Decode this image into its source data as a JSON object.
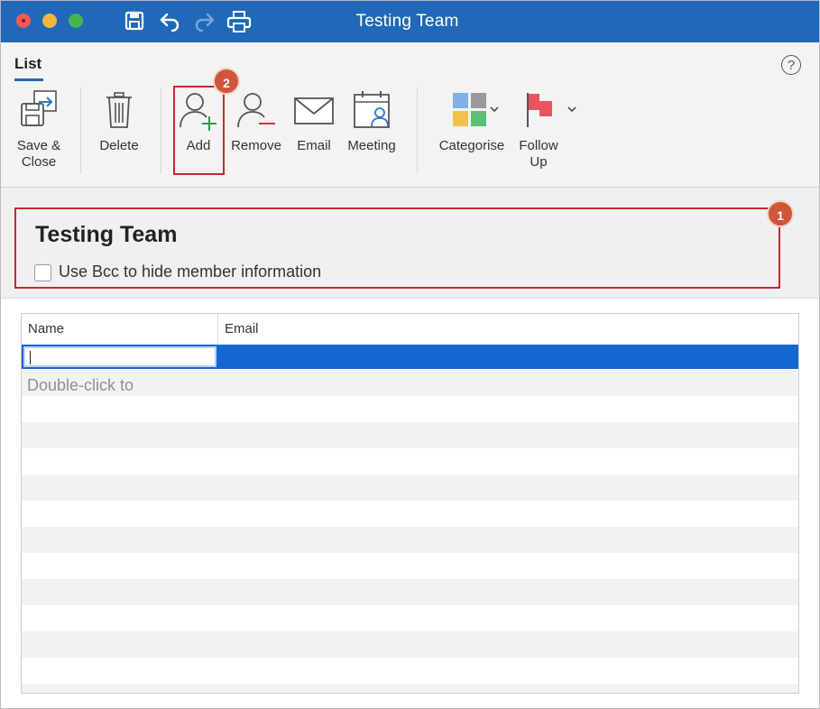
{
  "window": {
    "title": "Testing Team"
  },
  "ribbon": {
    "tab": "List",
    "help_symbol": "?",
    "buttons": {
      "save_close": [
        "Save &",
        "Close"
      ],
      "delete": "Delete",
      "add": "Add",
      "remove": "Remove",
      "email": "Email",
      "meeting": "Meeting",
      "categorise": "Categorise",
      "follow_up": [
        "Follow",
        "Up"
      ]
    }
  },
  "annotations": {
    "badge_1": "1",
    "badge_2": "2"
  },
  "list": {
    "name": "Testing Team",
    "bcc_label": "Use Bcc to hide member information",
    "bcc_checked": false
  },
  "members_table": {
    "columns": [
      "Name",
      "Email"
    ],
    "hint": "Double-click to"
  },
  "colors": {
    "titlebar": "#1f69b8",
    "selection": "#1666d2",
    "highlight": "#c8282e",
    "badge": "#d0553b"
  }
}
